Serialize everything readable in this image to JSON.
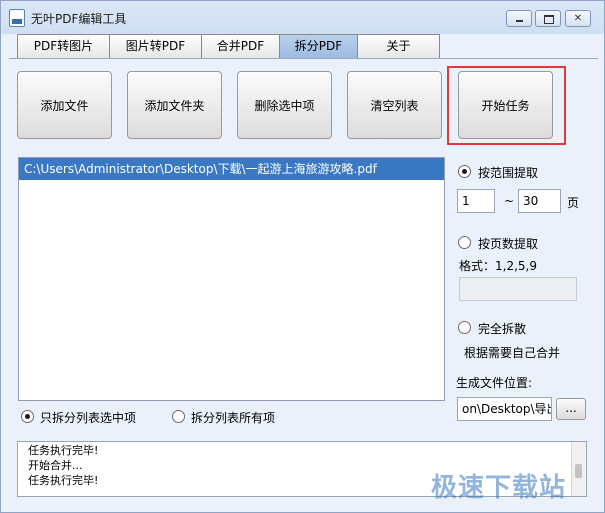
{
  "window": {
    "title": "无叶PDF编辑工具"
  },
  "tabs": [
    {
      "label": "PDF转图片"
    },
    {
      "label": "图片转PDF"
    },
    {
      "label": "合并PDF"
    },
    {
      "label": "拆分PDF"
    },
    {
      "label": "关于"
    }
  ],
  "active_tab": "拆分PDF",
  "toolbar": {
    "add_file": "添加文件",
    "add_folder": "添加文件夹",
    "delete_selected": "删除选中项",
    "clear_list": "清空列表",
    "start_task": "开始任务"
  },
  "file_list": {
    "items": [
      "C:\\Users\\Administrator\\Desktop\\下载\\一起游上海旅游攻略.pdf"
    ]
  },
  "options": {
    "range_label": "按范围提取",
    "range_from": "1",
    "range_sep": "~",
    "range_to": "30",
    "page_unit": "页",
    "pages_label": "按页数提取",
    "format_label": "格式：1,2,5,9",
    "pages_value": "",
    "split_all_label": "完全拆散",
    "merge_hint": "根据需要自己合并",
    "output_label": "生成文件位置:",
    "output_path": "on\\Desktop\\导出",
    "browse_label": "..."
  },
  "scope": {
    "selected_only": "只拆分列表选中项",
    "all_items": "拆分列表所有项"
  },
  "log": {
    "lines": [
      "任务执行完毕!",
      "开始合并...",
      "任务执行完毕!"
    ]
  },
  "watermark": "极速下载站"
}
